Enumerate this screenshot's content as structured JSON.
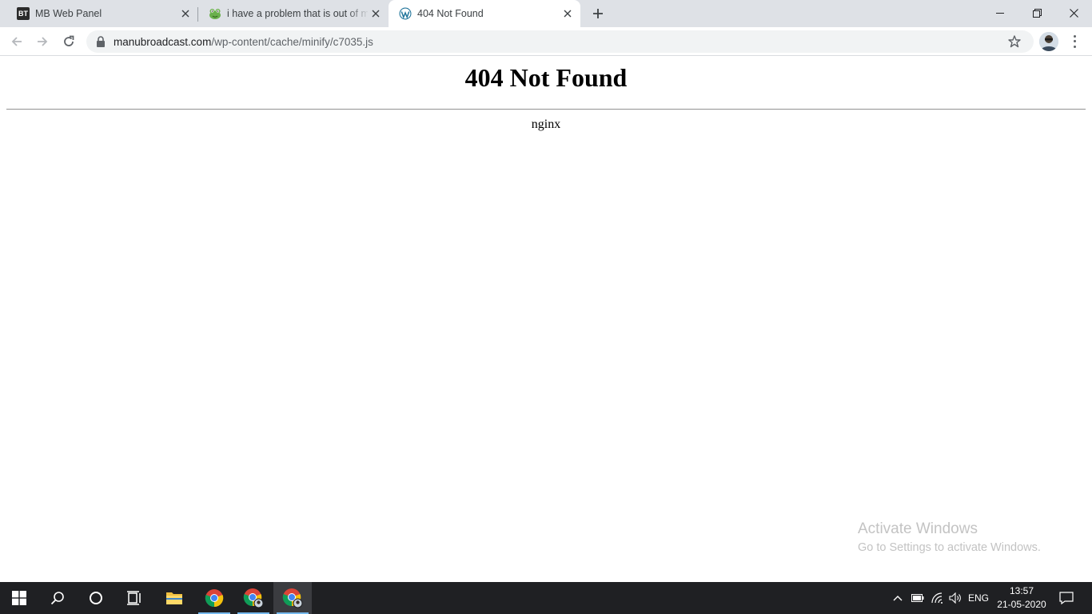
{
  "browser": {
    "tabs": [
      {
        "title": "MB Web Panel",
        "favicon": "bt-favicon-icon",
        "active": false
      },
      {
        "title": "i have a problem that is out of m",
        "favicon": "frog-favicon-icon",
        "active": false
      },
      {
        "title": "404 Not Found",
        "favicon": "wordpress-favicon-icon",
        "active": true
      }
    ],
    "favicon_text": {
      "bt": "BT"
    },
    "omnibox": {
      "host": "manubroadcast.com",
      "path": "/wp-content/cache/minify/c7035.js"
    }
  },
  "page": {
    "heading": "404 Not Found",
    "server": "nginx"
  },
  "watermark": {
    "title": "Activate Windows",
    "subtitle": "Go to Settings to activate Windows."
  },
  "taskbar": {
    "language": "ENG",
    "time": "13:57",
    "date": "21-05-2020",
    "apps": [
      "start-icon",
      "search-icon",
      "cortana-icon",
      "task-view-icon",
      "file-explorer-icon",
      "chrome-icon",
      "chrome-profile-icon",
      "chrome-profile-icon"
    ]
  },
  "colors": {
    "tabstrip": "#dee1e6",
    "taskbar": "#1f2023",
    "watermark": "#c3c3c3",
    "wordpress": "#21759b",
    "running_indicator": "#76b9ed"
  }
}
